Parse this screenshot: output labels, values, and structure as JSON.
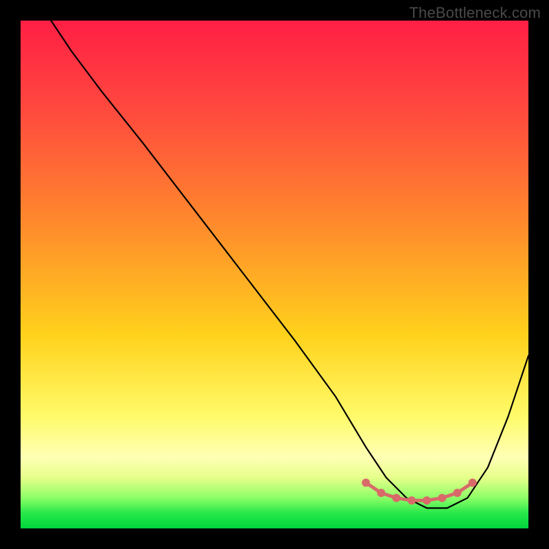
{
  "watermark": "TheBottleneck.com",
  "chart_data": {
    "type": "line",
    "title": "",
    "xlabel": "",
    "ylabel": "",
    "xlim": [
      0,
      100
    ],
    "ylim": [
      0,
      100
    ],
    "grid": false,
    "legend": false,
    "gradient_stops": [
      {
        "pos": 0,
        "color": "#ff1f44"
      },
      {
        "pos": 18,
        "color": "#ff4a3e"
      },
      {
        "pos": 40,
        "color": "#ff8a2c"
      },
      {
        "pos": 62,
        "color": "#ffd21c"
      },
      {
        "pos": 78,
        "color": "#fffb6a"
      },
      {
        "pos": 86,
        "color": "#ffffb5"
      },
      {
        "pos": 90,
        "color": "#e6ff8a"
      },
      {
        "pos": 94,
        "color": "#8cff66"
      },
      {
        "pos": 97,
        "color": "#27e84a"
      },
      {
        "pos": 100,
        "color": "#00d63b"
      }
    ],
    "series": [
      {
        "name": "bottleneck-curve",
        "color": "#000000",
        "x": [
          6,
          10,
          16,
          24,
          34,
          44,
          54,
          62,
          68,
          72,
          76,
          80,
          84,
          88,
          92,
          96,
          100
        ],
        "y": [
          100,
          94,
          86,
          76,
          63,
          50,
          37,
          26,
          16,
          10,
          6,
          4,
          4,
          6,
          12,
          22,
          34
        ]
      }
    ],
    "markers": {
      "name": "optimal-range",
      "color": "#d86a6a",
      "x": [
        68,
        71,
        74,
        77,
        80,
        83,
        86,
        89
      ],
      "y": [
        9,
        7,
        6,
        5.5,
        5.5,
        6,
        7,
        9
      ]
    }
  }
}
